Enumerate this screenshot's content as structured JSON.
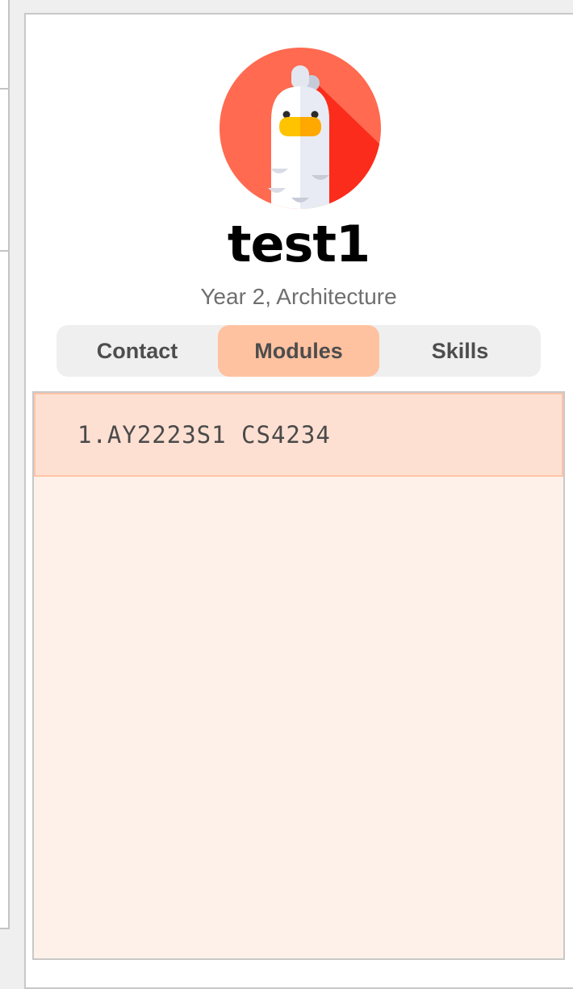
{
  "profile": {
    "name": "test1",
    "subtitle": "Year 2, Architecture",
    "avatar_icon": "rooster-icon"
  },
  "tabs": [
    {
      "label": "Contact",
      "active": false
    },
    {
      "label": "Modules",
      "active": true
    },
    {
      "label": "Skills",
      "active": false
    }
  ],
  "modules": {
    "items": [
      {
        "index": "1.",
        "text": "AY2223S1 CS4234"
      }
    ]
  },
  "colors": {
    "active_tab": "#ffc2a0",
    "list_background": "#fef1e9",
    "selected_item": "#fee0d2",
    "avatar_red": "#ff6a50"
  }
}
